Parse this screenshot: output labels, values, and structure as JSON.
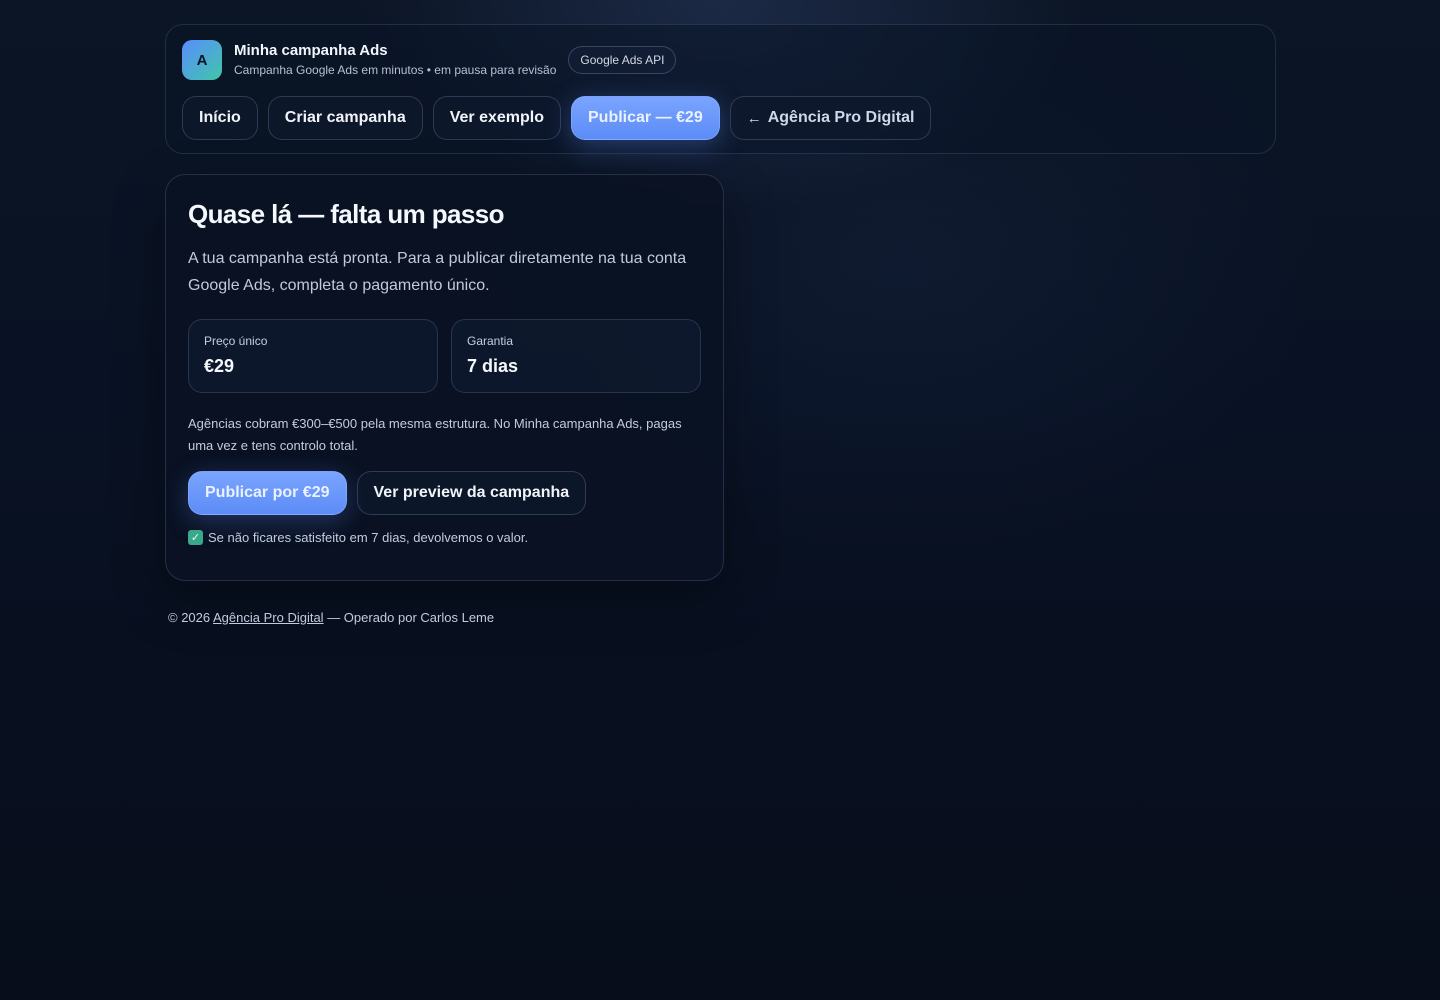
{
  "header": {
    "logo_letter": "A",
    "brand_name": "Minha campanha Ads",
    "brand_subtitle": "Campanha Google Ads em minutos • em pausa para revisão",
    "badge": "Google Ads API"
  },
  "nav": {
    "home": "Início",
    "create": "Criar campanha",
    "example": "Ver exemplo",
    "publish": "Publicar — €29",
    "arrow": "←",
    "agency": "Agência Pro Digital"
  },
  "card": {
    "title": "Quase lá — falta um passo",
    "lead": "A tua campanha está pronta. Para a publicar diretamente na tua conta Google Ads, completa o pagamento único.",
    "stats": [
      {
        "label": "Preço único",
        "value": "€29"
      },
      {
        "label": "Garantia",
        "value": "7 dias"
      }
    ],
    "note": "Agências cobram €300–€500 pela mesma estrutura. No Minha campanha Ads, pagas uma vez e tens controlo total.",
    "primary_button": "Publicar por €29",
    "secondary_button": "Ver preview da campanha",
    "guarantee_check": "✓",
    "guarantee": "Se não ficares satisfeito em 7 dias, devolvemos o valor."
  },
  "footer": {
    "prefix": "© 2026 ",
    "link": "Agência Pro Digital",
    "suffix": " — Operado por Carlos Leme"
  },
  "colors": {
    "accent": "#6b98fb",
    "background": "#091224",
    "check": "#3aa88a"
  }
}
